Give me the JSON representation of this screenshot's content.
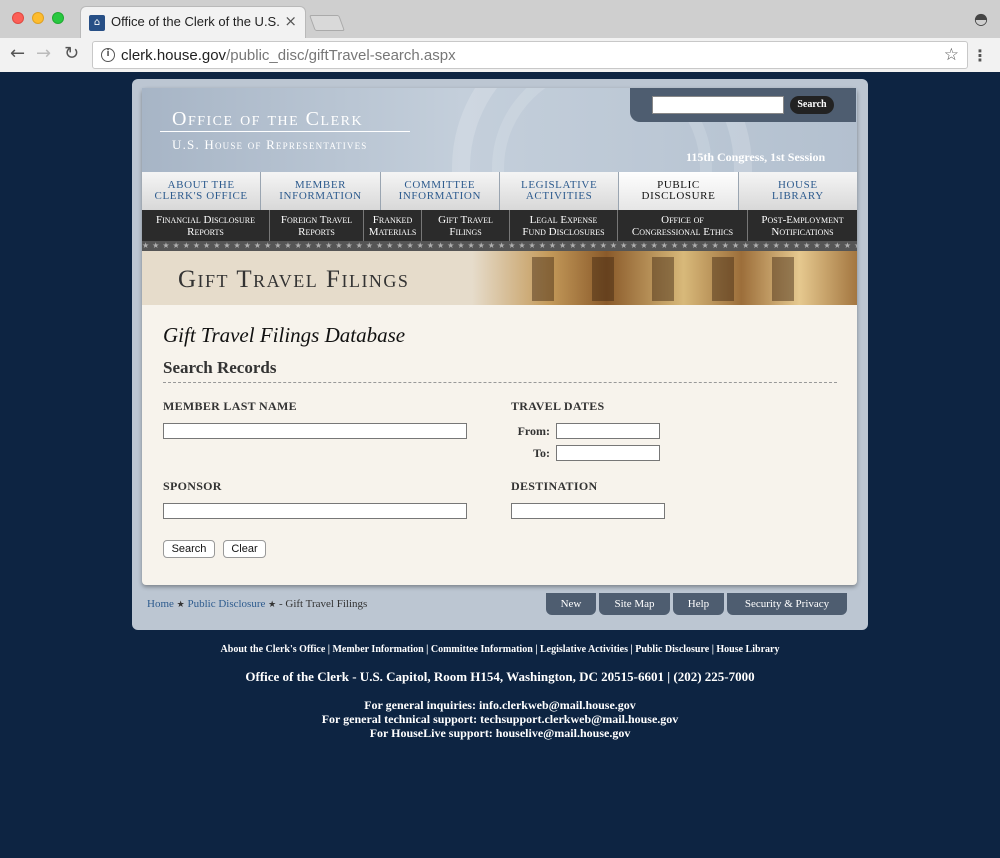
{
  "browser": {
    "tab_title": "Office of the Clerk of the U.S.",
    "url_domain": "clerk.house.gov",
    "url_path": "/public_disc/giftTravel-search.aspx"
  },
  "header": {
    "title": "Office of the Clerk",
    "subtitle": "U.S. House of Representatives",
    "session": "115th Congress, 1st Session",
    "search_button": "Search"
  },
  "main_nav": [
    {
      "line1": "About the",
      "line2": "Clerk's Office"
    },
    {
      "line1": "Member",
      "line2": "Information"
    },
    {
      "line1": "Committee",
      "line2": "Information"
    },
    {
      "line1": "Legislative",
      "line2": "Activities"
    },
    {
      "line1": "Public",
      "line2": "Disclosure"
    },
    {
      "line1": "House",
      "line2": "Library"
    }
  ],
  "sub_nav": [
    {
      "line1": "Financial Disclosure",
      "line2": "Reports"
    },
    {
      "line1": "Foreign Travel",
      "line2": "Reports"
    },
    {
      "line1": "Franked",
      "line2": "Materials"
    },
    {
      "line1": "Gift Travel",
      "line2": "Filings"
    },
    {
      "line1": "Legal Expense",
      "line2": "Fund Disclosures"
    },
    {
      "line1": "Office of",
      "line2": "Congressional Ethics"
    },
    {
      "line1": "Post-Employment",
      "line2": "Notifications"
    }
  ],
  "banner_title": "Gift Travel Filings",
  "content": {
    "heading": "Gift Travel Filings Database",
    "subheading": "Search Records",
    "member_last_name_label": "MEMBER LAST NAME",
    "travel_dates_label": "TRAVEL DATES",
    "from_label": "From:",
    "to_label": "To:",
    "sponsor_label": "SPONSOR",
    "destination_label": "DESTINATION",
    "search_button": "Search",
    "clear_button": "Clear"
  },
  "breadcrumb": {
    "home": "Home",
    "public_disclosure": "Public Disclosure",
    "current": "- Gift Travel Filings"
  },
  "utility_buttons": [
    "New",
    "Site Map",
    "Help",
    "Security & Privacy"
  ],
  "footer": {
    "links": "About the Clerk's Office | Member Information | Committee Information | Legislative Activities | Public Disclosure | House Library",
    "address": "Office of the Clerk - U.S. Capitol, Room H154, Washington, DC 20515-6601 | (202) 225-7000",
    "general_inquiries": "For general inquiries: info.clerkweb@mail.house.gov",
    "technical_support": "For general technical support: techsupport.clerkweb@mail.house.gov",
    "houselive_support": "For HouseLive support: houselive@mail.house.gov"
  },
  "colors": {
    "page_background": "#0d2442",
    "nav_link": "#2d5b8e",
    "content_background": "#f7f3ec"
  }
}
